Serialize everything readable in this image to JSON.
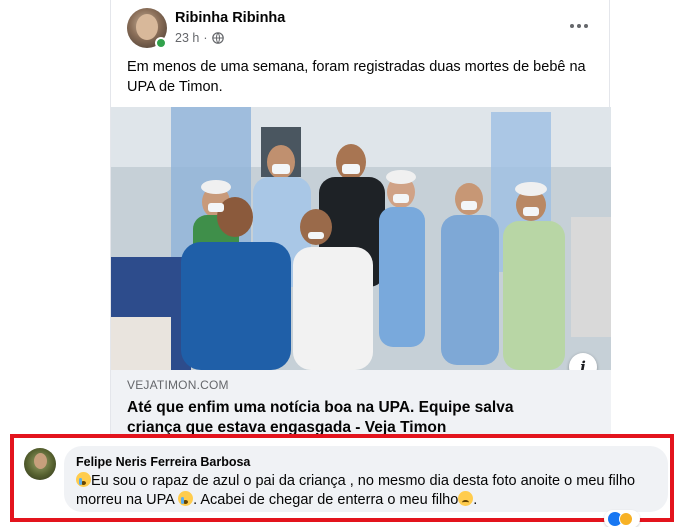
{
  "post": {
    "author": "Ribinha Ribinha",
    "timestamp": "23 h",
    "meta_separator": "·",
    "privacy_icon": "globe-icon",
    "text": "Em menos de uma semana, foram registradas duas mortes de bebê na UPA de Timon."
  },
  "link_preview": {
    "domain": "VEJATIMON.COM",
    "title": "Até que enfim uma notícia boa na UPA. Equipe salva criança que estava engasgada - Veja Timon",
    "info_label": "i"
  },
  "comment": {
    "author": "Felipe Neris Ferreira Barbosa",
    "text_part1": "Eu sou o rapaz de azul o pai da criança , no mesmo dia desta foto anoite o meu filho morreu na UPA",
    "text_part2": ". Acabei de chegar de enterra o meu filho",
    "reaction_count": "",
    "highlight_color": "#e3141d"
  },
  "colors": {
    "online": "#31a24c",
    "secondary_text": "#65676b",
    "preview_bg": "#f0f2f5"
  }
}
